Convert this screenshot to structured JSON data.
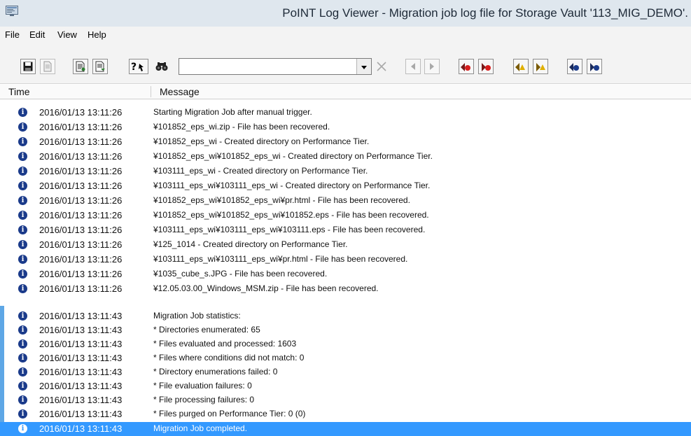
{
  "window": {
    "title": "PoINT Log Viewer - Migration job log file for Storage Vault '113_MIG_DEMO'."
  },
  "menu": [
    "File",
    "Edit",
    "View",
    "Help"
  ],
  "toolbar": {
    "search_value": "",
    "icons": [
      "save-icon",
      "export-icon",
      "log-icon",
      "log-next-icon",
      "help-pointer-icon",
      "find-icon",
      "clear-icon",
      "prev-icon",
      "next-icon",
      "first-error-icon",
      "next-error-icon",
      "first-warning-icon",
      "next-warning-icon",
      "first-info-icon",
      "next-info-icon"
    ]
  },
  "columns": {
    "time": "Time",
    "message": "Message"
  },
  "colors": {
    "info_icon": "#1a3a8a",
    "selection": "#3399ff",
    "error_marker": "#d81e1e",
    "warning_marker": "#e0b000"
  },
  "entries": [
    {
      "time": "2016/01/13 13:11:26",
      "message": "Starting Migration Job after manual trigger."
    },
    {
      "time": "2016/01/13 13:11:26",
      "message": "¥101852_eps_wi.zip - File has been recovered."
    },
    {
      "time": "2016/01/13 13:11:26",
      "message": "¥101852_eps_wi - Created directory on Performance Tier."
    },
    {
      "time": "2016/01/13 13:11:26",
      "message": "¥101852_eps_wi¥101852_eps_wi - Created directory on Performance Tier."
    },
    {
      "time": "2016/01/13 13:11:26",
      "message": "¥103111_eps_wi - Created directory on Performance Tier."
    },
    {
      "time": "2016/01/13 13:11:26",
      "message": "¥103111_eps_wi¥103111_eps_wi - Created directory on Performance Tier."
    },
    {
      "time": "2016/01/13 13:11:26",
      "message": "¥101852_eps_wi¥101852_eps_wi¥pr.html - File has been recovered."
    },
    {
      "time": "2016/01/13 13:11:26",
      "message": "¥101852_eps_wi¥101852_eps_wi¥101852.eps - File has been recovered."
    },
    {
      "time": "2016/01/13 13:11:26",
      "message": "¥103111_eps_wi¥103111_eps_wi¥103111.eps - File has been recovered."
    },
    {
      "time": "2016/01/13 13:11:26",
      "message": "¥125_1014 - Created directory on Performance Tier."
    },
    {
      "time": "2016/01/13 13:11:26",
      "message": "¥103111_eps_wi¥103111_eps_wi¥pr.html - File has been recovered."
    },
    {
      "time": "2016/01/13 13:11:26",
      "message": "¥1035_cube_s.JPG - File has been recovered."
    },
    {
      "time": "2016/01/13 13:11:26",
      "message": "¥12.05.03.00_Windows_MSM.zip - File has been recovered."
    }
  ],
  "stats_entries": [
    {
      "time": "2016/01/13 13:11:43",
      "message": "Migration Job statistics:"
    },
    {
      "time": "2016/01/13 13:11:43",
      "message": "* Directories enumerated: 65"
    },
    {
      "time": "2016/01/13 13:11:43",
      "message": "* Files evaluated and processed: 1603"
    },
    {
      "time": "2016/01/13 13:11:43",
      "message": "* Files where conditions did not match: 0"
    },
    {
      "time": "2016/01/13 13:11:43",
      "message": "* Directory enumerations failed: 0"
    },
    {
      "time": "2016/01/13 13:11:43",
      "message": "* File evaluation failures: 0"
    },
    {
      "time": "2016/01/13 13:11:43",
      "message": "* File processing failures: 0"
    },
    {
      "time": "2016/01/13 13:11:43",
      "message": "* Files purged on Performance Tier: 0 (0)"
    },
    {
      "time": "2016/01/13 13:11:43",
      "message": "Migration Job completed.",
      "selected": true
    }
  ]
}
